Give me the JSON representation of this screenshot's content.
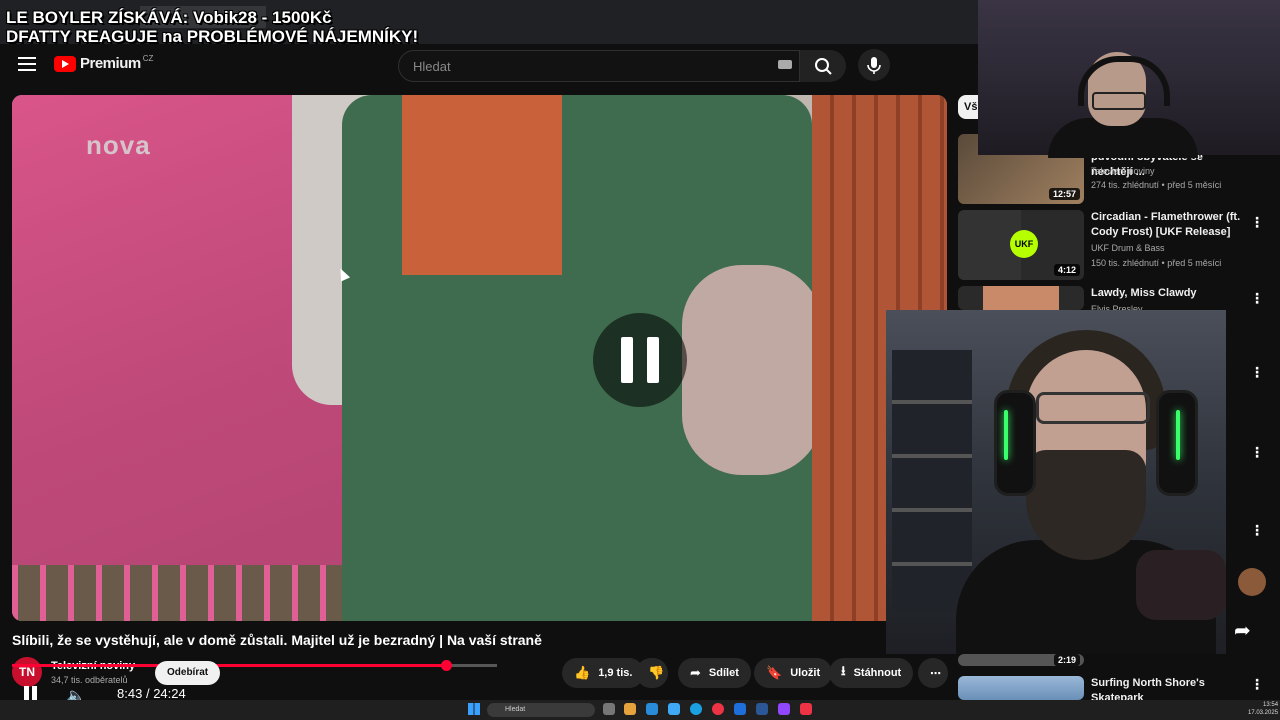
{
  "overlay": {
    "line1": "LE BOYLER ZÍSKÁVÁ: Vobik28 - 1500Kč",
    "line2": "DFATTY REAGUJE na PROBLÉMOVÉ NÁJEMNÍKY!"
  },
  "header": {
    "logo_text": "Premium",
    "logo_region": "CZ",
    "search_placeholder": "Hledat"
  },
  "video": {
    "watermark": "nova",
    "title": "Slíbili, že se vystěhují, ale v domě zůstali. Majitel už je bezradný | Na vaší straně",
    "progress_fraction": 0.358,
    "current_time": "8:43",
    "separator": "/",
    "duration": "24:24"
  },
  "channel": {
    "avatar_text": "TN",
    "name": "Televizní noviny",
    "subs": "34,7 tis. odběratelů",
    "subscribe_label": "Odebírat"
  },
  "actions": {
    "like_count": "1,9 tis.",
    "share_label": "Sdílet",
    "save_label": "Uložit",
    "download_label": "Stáhnout"
  },
  "sidebar": {
    "chip_label": "Vš",
    "items": [
      {
        "title": "původní obyvatele se nechtějí ...",
        "channel": "Televizní noviny",
        "meta": "274 tis. zhlédnutí • před 5 měsíci",
        "duration": "12:57"
      },
      {
        "title": "Circadian - Flamethrower (ft. Cody Frost) [UKF Release]",
        "channel": "UKF Drum & Bass",
        "meta": "150 tis. zhlédnutí • před 5 měsíci",
        "duration": "4:12"
      },
      {
        "title": "Lawdy, Miss Clawdy",
        "channel": "Elvis Presley",
        "meta": "",
        "duration": ""
      },
      {
        "title": "Surfing North Shore's Skatepark",
        "channel": "",
        "meta": "",
        "duration": "2:19"
      }
    ]
  },
  "taskbar": {
    "search_placeholder": "Hledat",
    "time": "13:54",
    "date": "17.03.2025"
  },
  "colors": {
    "accent": "#ff0033",
    "background": "#0f0f0f",
    "pill": "#272727"
  }
}
